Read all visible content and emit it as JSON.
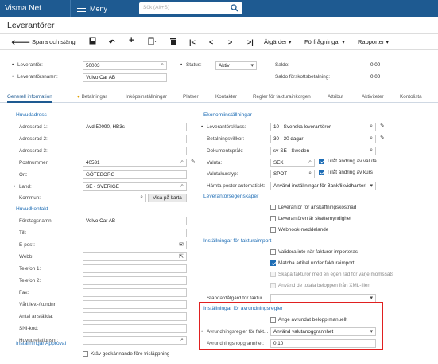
{
  "app": {
    "brand": "Visma Net",
    "menu_label": "Meny",
    "search_placeholder": "Sök (Alt+S)"
  },
  "page": {
    "title": "Leverantörer"
  },
  "toolbar": {
    "back_icon": "arrow-left-icon",
    "save_close": "Spara och stäng",
    "actions": "Åtgärder ▾",
    "inquiries": "Förfrågningar ▾",
    "reports": "Rapporter ▾"
  },
  "summary": {
    "supplier_label": "Leverantör:",
    "supplier_value": "50003",
    "supplier_name_label": "Leverantörsnamn:",
    "supplier_name_value": "Volvo Car AB",
    "status_label": "Status:",
    "status_value": "Aktiv",
    "balance_label": "Saldo:",
    "balance_value": "0,00",
    "prepay_label": "Saldo förskottsbetalning:",
    "prepay_value": "0,00"
  },
  "tabs": [
    "Generell information",
    "Betalningar",
    "Inköpsinställningar",
    "Platser",
    "Kontakter",
    "Regler för fakturainkorgen",
    "Attribut",
    "Aktiviteter",
    "Kontolista"
  ],
  "left": {
    "main_address_title": "Huvudadress",
    "addr1_label": "Adressrad 1:",
    "addr1_value": "Avd 50090, HB3s",
    "addr2_label": "Adressrad 2:",
    "addr2_value": "",
    "addr3_label": "Adressrad 3:",
    "addr3_value": "",
    "postal_label": "Postnummer:",
    "postal_value": "40531",
    "city_label": "Ort:",
    "city_value": "GÖTEBORG",
    "country_label": "Land:",
    "country_value": "SE - SVERIGE",
    "municipality_label": "Kommun:",
    "municipality_value": "",
    "map_button": "Visa på karta",
    "main_contact_title": "Huvudkontakt",
    "company_label": "Företagsnamn:",
    "company_value": "Volvo Car AB",
    "to_label": "Till:",
    "email_label": "E-post:",
    "web_label": "Webb:",
    "phone1_label": "Telefon 1:",
    "phone2_label": "Telefon 2:",
    "fax_label": "Fax:",
    "our_cust_label": "Vårt lev.-/kundnr:",
    "employees_label": "Antal anställda:",
    "sni_label": "SNI-kod:",
    "main_rel_label": "Huvudrelationsnr:",
    "approval_title": "Inställningar Approval",
    "approval_check": "Kräv godkännande före frisläppning"
  },
  "right": {
    "econ_title": "Ekonomiinställningar",
    "class_label": "Leverantörsklass:",
    "class_value": "10 - Svenska leverantörer",
    "terms_label": "Betalningsvillkor:",
    "terms_value": "30 - 30 dagar",
    "lang_label": "Dokumentspråk:",
    "lang_value": "sv-SE - Sweden",
    "currency_label": "Valuta:",
    "currency_value": "SEK",
    "allow_currency": "Tillåt ändring av valuta",
    "rate_type_label": "Valutakurstyp:",
    "rate_type_value": "SPOT",
    "allow_rate": "Tillåt ändring av kurs",
    "fetch_label": "Hämta poster automatiskt:",
    "fetch_value": "Använd inställningar för Bank/likvidhanteri",
    "props_title": "Leverantörsegenskaper",
    "prop1": "Leverantör för anskaffningskostnad",
    "prop2": "Leverantören är skattemyndighet",
    "prop3": "Webhook-meddelande",
    "invimp_title": "Inställningar för fakturaimport",
    "imp1": "Validera inte när fakturor importeras",
    "imp2": "Matcha artikel under fakturaimport",
    "imp3": "Skapa fakturor med en egen rad för varje momssats",
    "imp4": "Använd de totala beloppen från XML-filen",
    "std_action_label": "Standardåtgärd för faktur...",
    "std_action_value": "",
    "rounding_title": "Inställningar för avrundningsregler",
    "round_manual": "Ange avrundat belopp manuellt",
    "round_rule_label": "Avrundningsregler för fakt...",
    "round_rule_value": "Använd valutanoggrannhet",
    "round_prec_label": "Avrundningsnoggrannhet:",
    "round_prec_value": "0.10"
  },
  "colors": {
    "topbar": "#1e5a91",
    "accent": "#1e6db5",
    "highlight_box": "#e02020"
  }
}
